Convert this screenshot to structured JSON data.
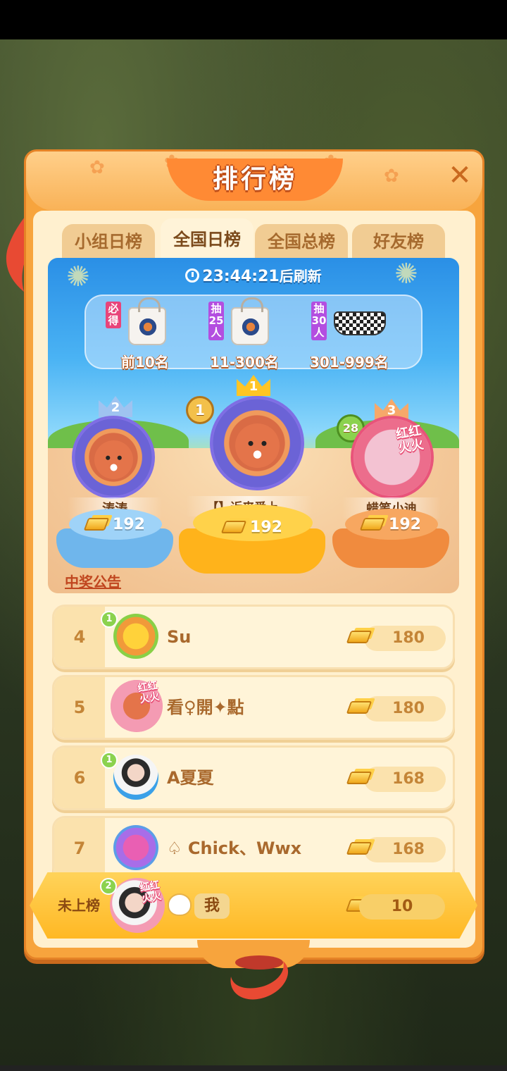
{
  "title": "排行榜",
  "tabs": [
    {
      "label": "小组日榜",
      "active": false
    },
    {
      "label": "全国日榜",
      "active": true
    },
    {
      "label": "全国总榜",
      "active": false
    },
    {
      "label": "好友榜",
      "active": false
    }
  ],
  "timer": {
    "time": "23:44:21",
    "suffix": "后刷新"
  },
  "prizes": [
    {
      "tag": "必得",
      "range": "前10名",
      "item": "tote-bag"
    },
    {
      "tag": "抽25人",
      "range": "11-300名",
      "item": "tote-bag"
    },
    {
      "tag": "抽30人",
      "range": "301-999名",
      "item": "belt-bag"
    }
  ],
  "podium": [
    {
      "rank": "2",
      "name": "涛涛",
      "score": "192"
    },
    {
      "rank": "1",
      "name": "【】近来爱上...",
      "score": "192",
      "level": "1"
    },
    {
      "rank": "3",
      "name": "蜡笔小迪",
      "score": "192",
      "level": "28",
      "avatar_text": "红红火火"
    }
  ],
  "notice": "中奖公告",
  "rows": [
    {
      "rank": "4",
      "name": "Su",
      "score": "180",
      "level": "1"
    },
    {
      "rank": "5",
      "name": "看♀開✦點",
      "score": "180",
      "avatar_text": "红红火火"
    },
    {
      "rank": "6",
      "name": "A夏夏",
      "score": "168",
      "level": "1"
    },
    {
      "rank": "7",
      "name": "♤ Chick、Wwx",
      "score": "168"
    }
  ],
  "me": {
    "rank_label": "未上榜",
    "name": "我",
    "score": "10",
    "level": "2",
    "avatar_text": "红红火火"
  },
  "colors": {
    "panel": "#f7a43d",
    "accent": "#ff8a34",
    "gold": "#ffb824"
  }
}
